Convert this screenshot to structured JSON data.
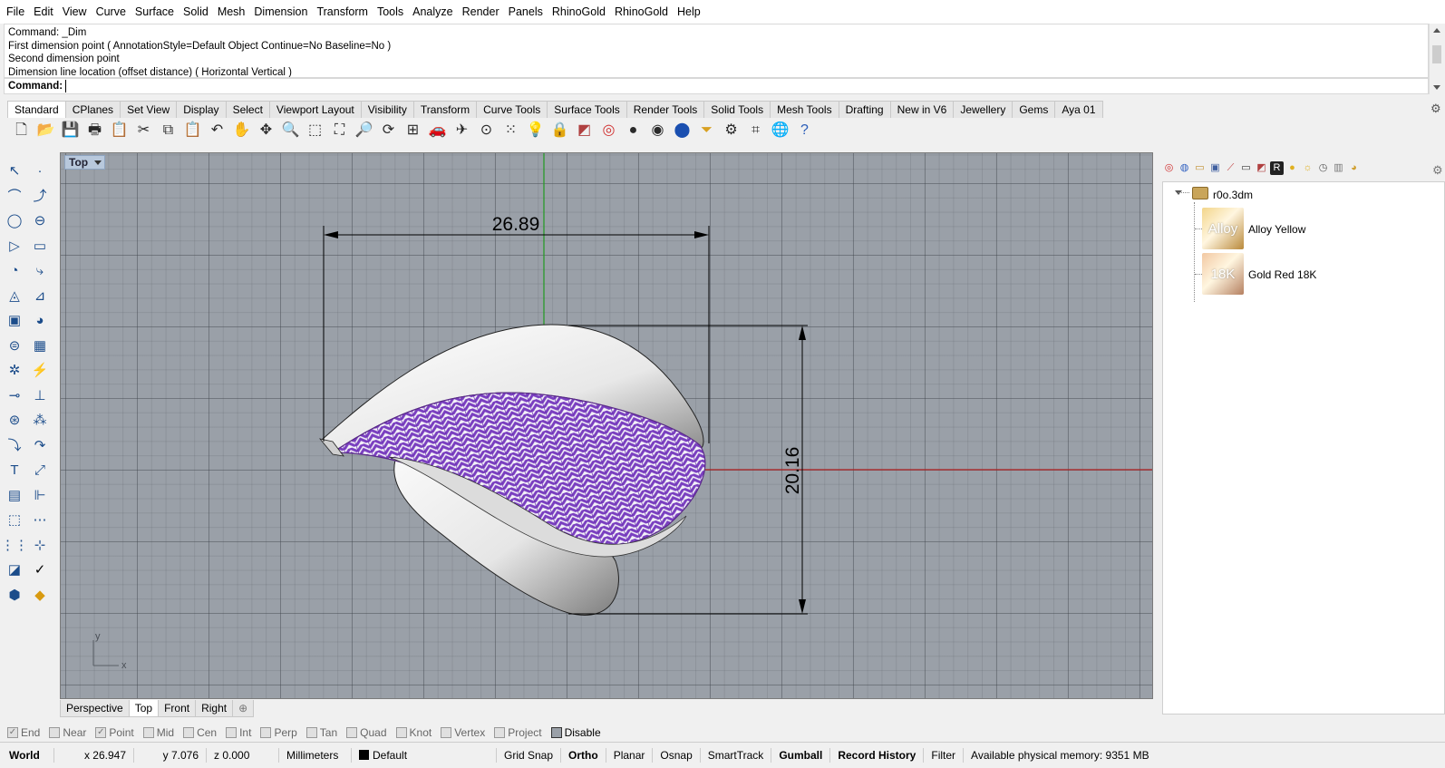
{
  "menu": [
    "File",
    "Edit",
    "View",
    "Curve",
    "Surface",
    "Solid",
    "Mesh",
    "Dimension",
    "Transform",
    "Tools",
    "Analyze",
    "Render",
    "Panels",
    "RhinoGold",
    "RhinoGold",
    "Help"
  ],
  "command_history": [
    "Command: _Dim",
    "First dimension point ( AnnotationStyle=Default  Object  Continue=No  Baseline=No )",
    "Second dimension point",
    "Dimension line location (offset distance) ( Horizontal  Vertical )"
  ],
  "command_prompt": {
    "label": "Command:",
    "value": ""
  },
  "toolbar_tabs": [
    "Standard",
    "CPlanes",
    "Set View",
    "Display",
    "Select",
    "Viewport Layout",
    "Visibility",
    "Transform",
    "Curve Tools",
    "Surface Tools",
    "Render Tools",
    "Solid Tools",
    "Mesh Tools",
    "Drafting",
    "New in V6",
    "Jewellery",
    "Gems",
    "Aya 01"
  ],
  "active_toolbar_tab": "Standard",
  "toolbar_icons": [
    "new-icon",
    "open-icon",
    "save-icon",
    "print-icon",
    "import-icon",
    "cut-icon",
    "copy-icon",
    "paste-icon",
    "undo-icon",
    "pan-icon",
    "rotate-view-icon",
    "zoom-icon",
    "zoom-window-icon",
    "zoom-extents-icon",
    "zoom-selected-icon",
    "rotate-icon",
    "four-viewports-icon",
    "car-icon",
    "plane-icon",
    "target-icon",
    "points-icon",
    "light-bulb-icon",
    "lock-icon",
    "layer-icon",
    "color-wheel-icon",
    "shaded-sphere-icon",
    "rendered-sphere-icon",
    "blue-sphere-icon",
    "funnel-icon",
    "gears-icon",
    "snap-icon",
    "globe-icon",
    "help-icon"
  ],
  "viewport": {
    "title": "Top",
    "dimension_horizontal": "26.89",
    "dimension_vertical": "20.16",
    "axis_y": "y",
    "axis_x": "x"
  },
  "viewport_tabs": [
    "Perspective",
    "Top",
    "Front",
    "Right"
  ],
  "active_viewport_tab": "Top",
  "materials_panel": {
    "file_name": "r0o.3dm",
    "materials": [
      {
        "thumb_text": "Alloy",
        "name": "Alloy Yellow",
        "color_a": "#f3d58a",
        "color_b": "#b9893a"
      },
      {
        "thumb_text": "18K",
        "name": "Gold Red 18K",
        "color_a": "#f2c8a2",
        "color_b": "#b58060"
      }
    ]
  },
  "osnaps": [
    {
      "label": "End",
      "checked": true,
      "enabled": false
    },
    {
      "label": "Near",
      "checked": false,
      "enabled": false
    },
    {
      "label": "Point",
      "checked": true,
      "enabled": false
    },
    {
      "label": "Mid",
      "checked": false,
      "enabled": false
    },
    {
      "label": "Cen",
      "checked": false,
      "enabled": false
    },
    {
      "label": "Int",
      "checked": false,
      "enabled": false
    },
    {
      "label": "Perp",
      "checked": false,
      "enabled": false
    },
    {
      "label": "Tan",
      "checked": false,
      "enabled": false
    },
    {
      "label": "Quad",
      "checked": false,
      "enabled": false
    },
    {
      "label": "Knot",
      "checked": false,
      "enabled": false
    },
    {
      "label": "Vertex",
      "checked": false,
      "enabled": false
    },
    {
      "label": "Project",
      "checked": false,
      "enabled": false
    },
    {
      "label": "Disable",
      "checked": false,
      "enabled": true
    }
  ],
  "status": {
    "cplane": "World",
    "x": "x 26.947",
    "y": "y 7.076",
    "z": "z 0.000",
    "units": "Millimeters",
    "layer": "Default",
    "grid_snap": "Grid Snap",
    "ortho": "Ortho",
    "planar": "Planar",
    "osnap": "Osnap",
    "smarttrack": "SmartTrack",
    "gumball": "Gumball",
    "record_history": "Record History",
    "filter": "Filter",
    "memory": "Available physical memory: 9351 MB"
  },
  "colors": {
    "viewport_bg": "#9aa0a8",
    "lattice_purple": "#7a3fc0",
    "x_axis_red": "#b02020",
    "y_axis_green": "#2a9a2a"
  }
}
